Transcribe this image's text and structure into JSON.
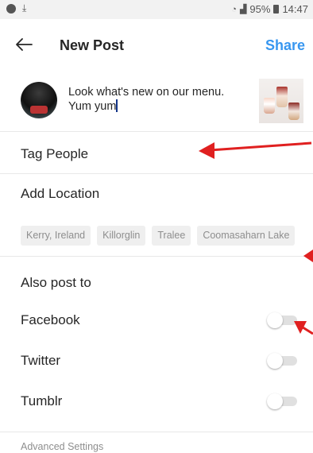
{
  "status_bar": {
    "battery_percent": "95%",
    "time": "14:47",
    "icons": [
      "notification-icon",
      "download-icon",
      "wifi-icon",
      "signal-icon",
      "battery-icon"
    ]
  },
  "header": {
    "back_icon": "arrow-left-icon",
    "title": "New Post",
    "share_label": "Share"
  },
  "composer": {
    "caption_line1": "Look what's new on our menu.",
    "caption_line2": "Yum yum"
  },
  "options": {
    "tag_people": "Tag People",
    "add_location": "Add Location",
    "location_suggestions": [
      "Kerry, Ireland",
      "Killorglin",
      "Tralee",
      "Coomasaharn Lake"
    ]
  },
  "also_post": {
    "heading": "Also post to",
    "networks": [
      {
        "label": "Facebook",
        "enabled": false
      },
      {
        "label": "Twitter",
        "enabled": false
      },
      {
        "label": "Tumblr",
        "enabled": false
      }
    ]
  },
  "advanced_label": "Advanced Settings",
  "colors": {
    "accent": "#3897f0",
    "annotation_arrow": "#e02020"
  }
}
